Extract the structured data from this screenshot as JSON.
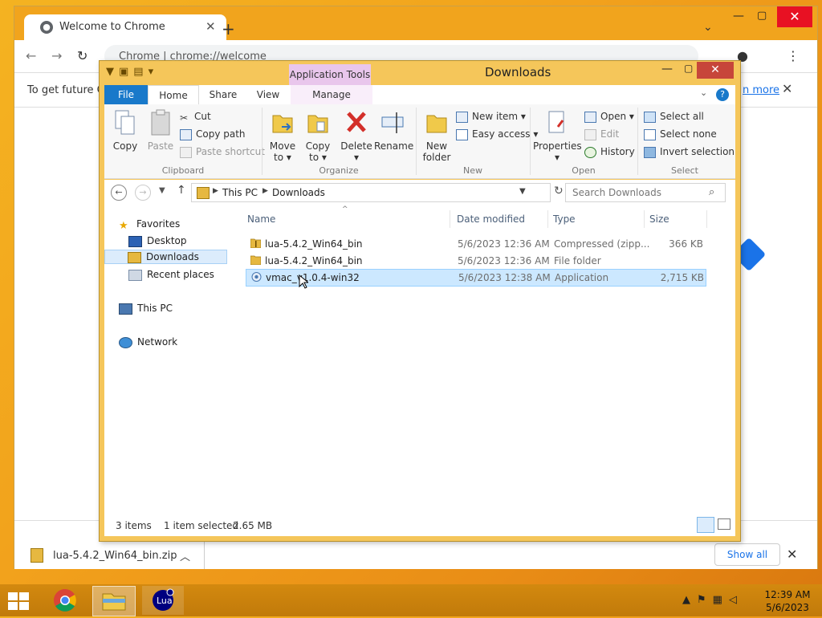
{
  "chrome": {
    "tab_title": "Welcome to Chrome",
    "omnibox_scheme": "Chrome",
    "omnibox_url": "chrome://welcome",
    "infobar_text": "To get future Go",
    "infobar_link": "n more",
    "download_file": "lua-5.4.2_Win64_bin.zip",
    "show_all_label": "Show all"
  },
  "explorer": {
    "context_tab": "Application Tools",
    "title": "Downloads",
    "tabs": [
      "File",
      "Home",
      "Share",
      "View",
      "Manage"
    ],
    "ribbon": {
      "clipboard": {
        "label": "Clipboard",
        "copy": "Copy",
        "paste": "Paste",
        "cut": "Cut",
        "copy_path": "Copy path",
        "paste_shortcut": "Paste shortcut"
      },
      "organize": {
        "label": "Organize",
        "move_to": "Move",
        "move_to_2": "to ▾",
        "copy_to": "Copy",
        "copy_to_2": "to ▾",
        "delete": "Delete",
        "delete_2": "▾",
        "rename": "Rename"
      },
      "new": {
        "label": "New",
        "new_folder": "New",
        "new_folder_2": "folder",
        "new_item": "New item ▾",
        "easy_access": "Easy access ▾"
      },
      "open": {
        "label": "Open",
        "properties": "Properties",
        "properties_2": "▾",
        "open_btn": "Open ▾",
        "edit": "Edit",
        "history": "History"
      },
      "select": {
        "label": "Select",
        "select_all": "Select all",
        "select_none": "Select none",
        "invert": "Invert selection"
      }
    },
    "address": {
      "part1": "This PC",
      "part2": "Downloads"
    },
    "search_placeholder": "Search Downloads",
    "nav": {
      "favorites": "Favorites",
      "desktop": "Desktop",
      "downloads": "Downloads",
      "recent": "Recent places",
      "this_pc": "This PC",
      "network": "Network"
    },
    "columns": {
      "name": "Name",
      "date": "Date modified",
      "type": "Type",
      "size": "Size"
    },
    "files": [
      {
        "name": "lua-5.4.2_Win64_bin",
        "date": "5/6/2023 12:36 AM",
        "type": "Compressed (zipp...",
        "size": "366 KB",
        "icon": "zip-folder-icon"
      },
      {
        "name": "lua-5.4.2_Win64_bin",
        "date": "5/6/2023 12:36 AM",
        "type": "File folder",
        "size": "",
        "icon": "folder-icon"
      },
      {
        "name": "vmac_v1.0.4-win32",
        "date": "5/6/2023 12:38 AM",
        "type": "Application",
        "size": "2,715 KB",
        "icon": "application-icon"
      }
    ],
    "status": {
      "items": "3 items",
      "selected": "1 item selected",
      "size": "2.65 MB"
    }
  },
  "taskbar": {
    "time": "12:39 AM",
    "date": "5/6/2023",
    "lua_label": "Lua"
  },
  "colors": {
    "accent": "#1979ca",
    "selection": "#cce8ff",
    "desktop": "#f2a21c"
  }
}
